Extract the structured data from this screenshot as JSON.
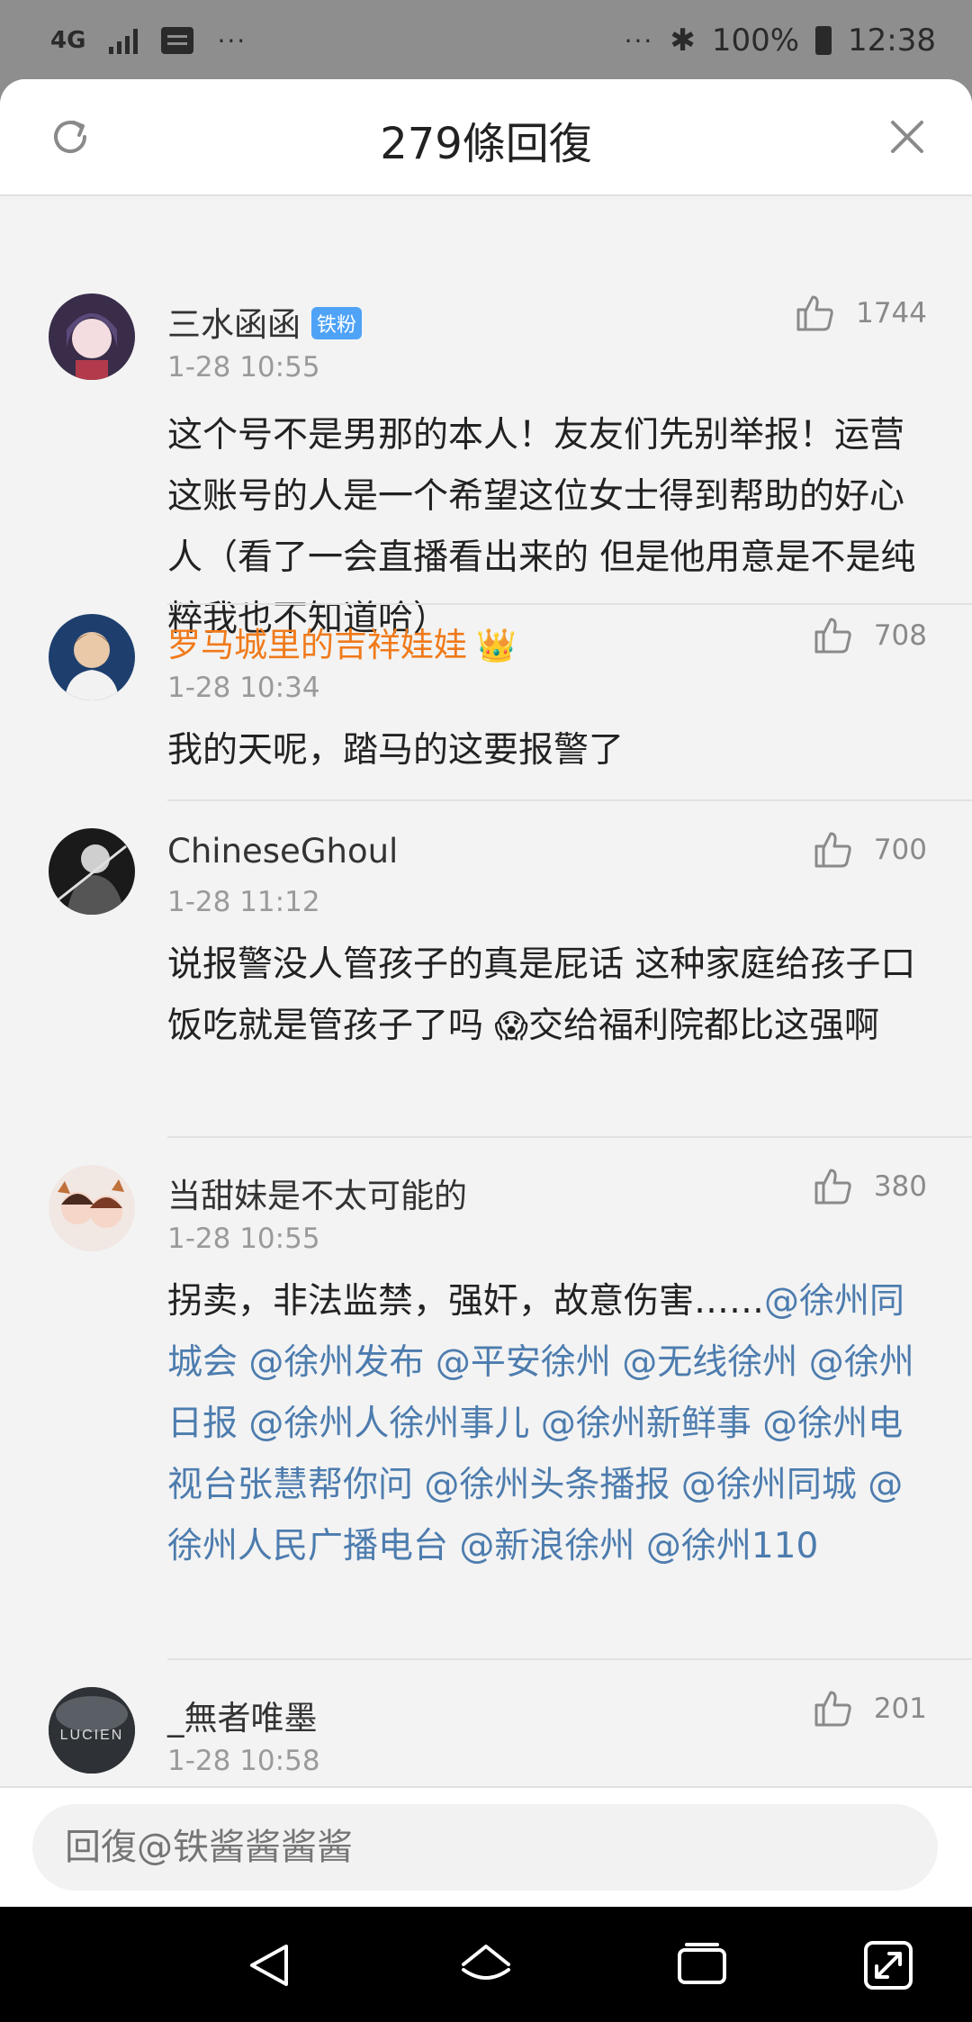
{
  "status_bar": {
    "network": "4G",
    "dots_left": "···",
    "dots_right": "···",
    "bluetooth": "✱",
    "battery": "100%",
    "time": "12:38"
  },
  "sheet": {
    "title": "279條回復",
    "refresh_icon": "refresh-icon",
    "close_icon": "close-icon"
  },
  "comments": [
    {
      "username": "三水函函",
      "badge": "铁粉",
      "time": "1-28 10:55",
      "likes": "1744",
      "text": "这个号不是男那的本人！友友们先别举报！运营这账号的人是一个希望这位女士得到帮助的好心人（看了一会直播看出来的 但是他用意是不是纯粹我也不知道哈）"
    },
    {
      "username": "罗马城里的吉祥娃娃",
      "time": "1-28 10:34",
      "likes": "708",
      "text": "我的天呢，踏马的这要报警了"
    },
    {
      "username": "ChineseGhoul",
      "time": "1-28 11:12",
      "likes": "700",
      "text_a": "说报警没人管孩子的真是屁话 这种家庭给孩子口饭吃就是管孩子了吗 ",
      "emoji": "😱",
      "text_b": "交给福利院都比这强啊"
    },
    {
      "username": "当甜妹是不太可能的",
      "time": "1-28 10:55",
      "likes": "380",
      "text": "拐卖，非法监禁，强奸，故意伤害……",
      "mentions": [
        "@徐州同城会",
        "@徐州发布",
        "@平安徐州",
        "@无线徐州",
        "@徐州日报",
        "@徐州人徐州事儿",
        "@徐州新鲜事",
        "@徐州电视台张慧帮你问",
        "@徐州头条播报",
        "@徐州同城",
        "@徐州人民广播电台",
        "@新浪徐州",
        "@徐州110"
      ]
    },
    {
      "username": "_無者唯墨",
      "time": "1-28 10:58",
      "likes": "201",
      "avatar_text": "LUCIEN"
    }
  ],
  "reply": {
    "placeholder": "回復@铁酱酱酱酱"
  },
  "colors": {
    "accent_link": "#4d7cae",
    "gold_name": "#f07a1a",
    "badge": "#4fa3f7"
  }
}
